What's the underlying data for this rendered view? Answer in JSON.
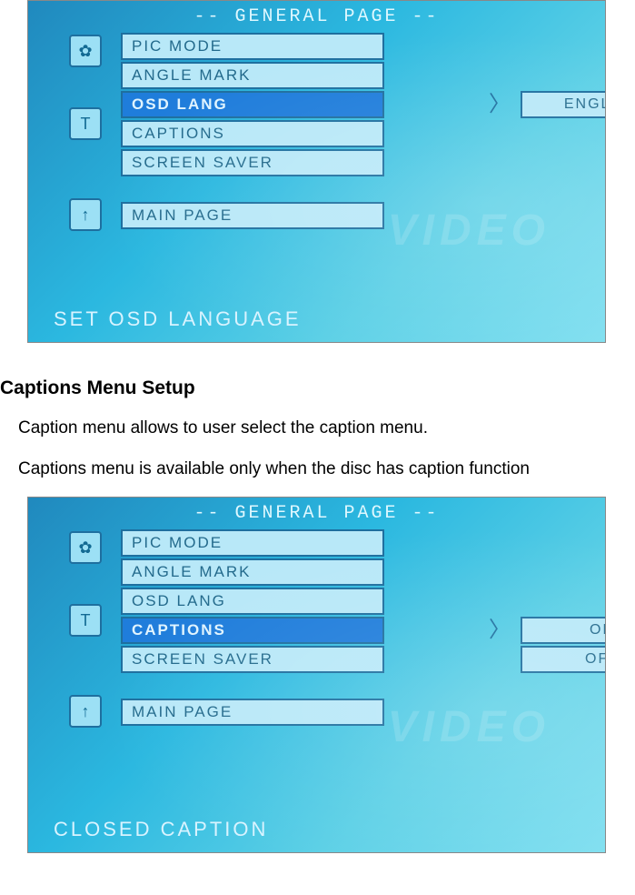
{
  "screen1": {
    "header": "--  GENERAL PAGE  --",
    "items": {
      "pic_mode": "PIC MODE",
      "angle_mark": "ANGLE MARK",
      "osd_lang": "OSD LANG",
      "captions": "CAPTIONS",
      "screen_saver": "SCREEN SAVER",
      "main_page": "MAIN PAGE"
    },
    "value_english": "ENGLISH",
    "status": "SET  OSD  LANGUAGE",
    "watermark": "VIDEO"
  },
  "section": {
    "title": "Captions Menu Setup",
    "line1": "Caption menu allows to user select the caption menu.",
    "line2": "Captions menu is available only when the disc has caption function"
  },
  "screen2": {
    "header": "--  GENERAL PAGE  --",
    "items": {
      "pic_mode": "PIC MODE",
      "angle_mark": "ANGLE MARK",
      "osd_lang": "OSD LANG",
      "captions": "CAPTIONS",
      "screen_saver": "SCREEN SAVER",
      "main_page": "MAIN PAGE"
    },
    "value_on": "ON",
    "value_off": "OFF",
    "status": "CLOSED  CAPTION",
    "watermark": "VIDEO"
  }
}
